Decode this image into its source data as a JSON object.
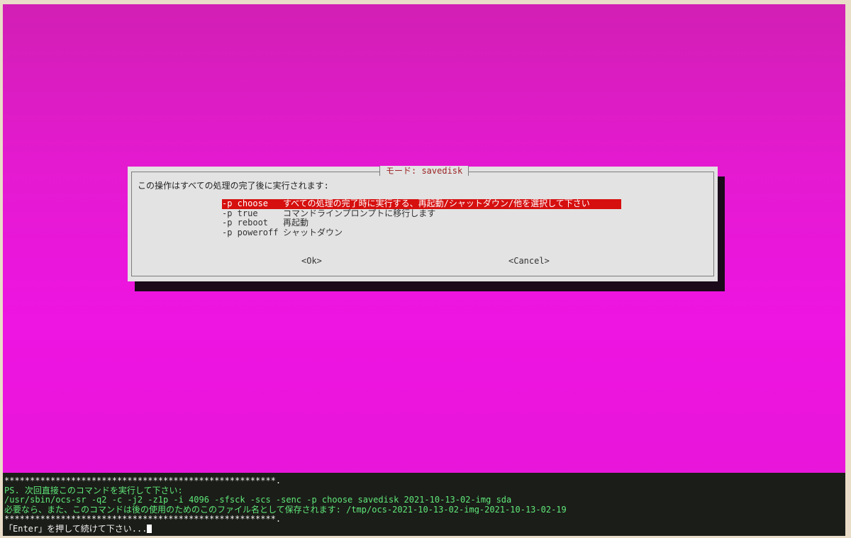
{
  "dialog": {
    "title": "モード: savedisk",
    "prompt": "この操作はすべての処理の完了後に実行されます:",
    "items": [
      {
        "option": "-p choose",
        "description": "すべての処理の完了時に実行する、再起動/シャットダウン/他を選択して下さい",
        "selected": true
      },
      {
        "option": "-p true",
        "description": "コマンドラインプロンプトに移行します",
        "selected": false
      },
      {
        "option": "-p reboot",
        "description": "再起動",
        "selected": false
      },
      {
        "option": "-p poweroff",
        "description": "シャットダウン",
        "selected": false
      }
    ],
    "ok_label": "<Ok>",
    "cancel_label": "<Cancel>"
  },
  "console": {
    "separator_top": "*****************************************************.",
    "line_ps": "PS. 次回直接このコマンドを実行して下さい:",
    "line_command": "/usr/sbin/ocs-sr -q2 -c -j2 -z1p -i 4096 -sfsck -scs -senc -p choose savedisk 2021-10-13-02-img sda",
    "line_saved": "必要なら、また、このコマンドは後の使用のためのこのファイル名として保存されます: /tmp/ocs-2021-10-13-02-img-2021-10-13-02-19",
    "separator_bottom": "*****************************************************.",
    "line_enter": "「Enter」を押して続けて下さい..."
  },
  "colors": {
    "background_magenta": "#e616d6",
    "selection_red": "#d60f0f",
    "console_green": "#5fe87a",
    "console_bg": "#1b1d18"
  }
}
